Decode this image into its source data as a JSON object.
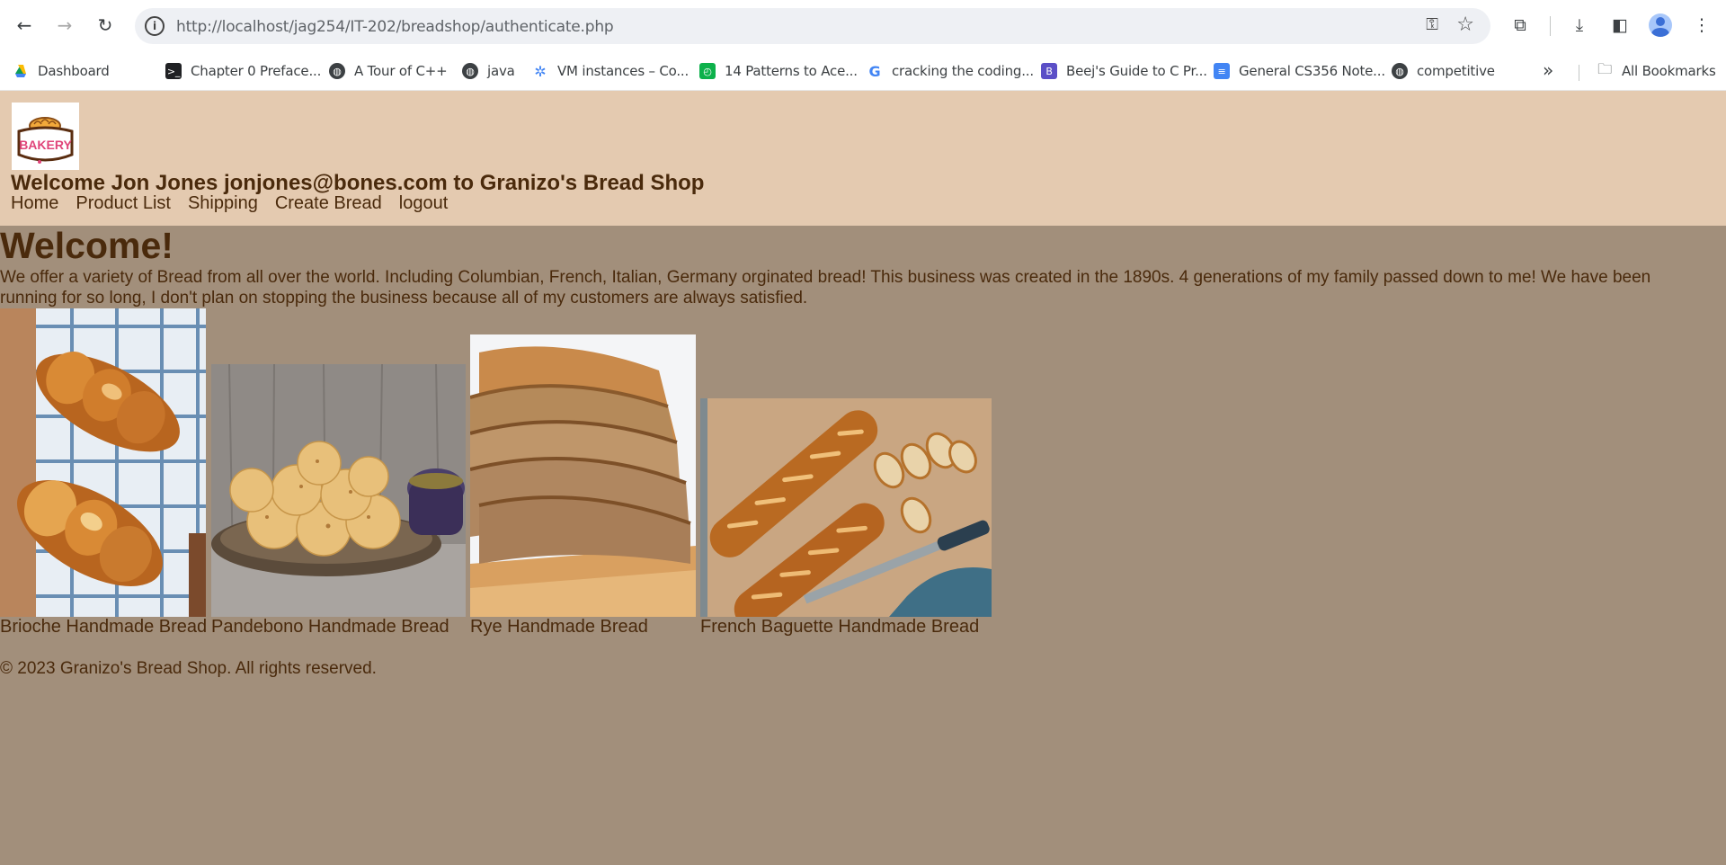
{
  "browser": {
    "url": "http://localhost/jag254/IT-202/breadshop/authenticate.php",
    "bookmarks": [
      {
        "label": "Dashboard",
        "icon": "google-drive-icon",
        "color": "#1a73e8"
      },
      {
        "label": "Chapter 0 Preface...",
        "icon": "terminal-icon",
        "color": "#202124"
      },
      {
        "label": "A Tour of C++",
        "icon": "globe-icon",
        "color": "#3c4043"
      },
      {
        "label": "java",
        "icon": "globe-icon",
        "color": "#3c4043"
      },
      {
        "label": "VM instances – Co...",
        "icon": "cloud-chip-icon",
        "color": "#4285f4"
      },
      {
        "label": "14 Patterns to Ace...",
        "icon": "clock-icon",
        "color": "#0db14b"
      },
      {
        "label": "cracking the coding...",
        "icon": "google-icon",
        "color": "#4285f4"
      },
      {
        "label": "Beej's Guide to C Pr...",
        "icon": "beej-icon",
        "color": "#5b4fc7"
      },
      {
        "label": "General CS356 Note...",
        "icon": "docs-icon",
        "color": "#4285f4"
      },
      {
        "label": "competitive",
        "icon": "globe-icon",
        "color": "#3c4043"
      }
    ],
    "all_bookmarks_label": "All Bookmarks"
  },
  "site": {
    "logo_text": "BAKERY",
    "welcome": "Welcome Jon Jones jonjones@bones.com to Granizo's Bread Shop",
    "nav": [
      "Home",
      "Product List",
      "Shipping",
      "Create Bread",
      "logout"
    ]
  },
  "main": {
    "title": "Welcome!",
    "intro": "We offer a variety of Bread from all over the world. Including Columbian, French, Italian, Germany orginated bread! This business was created in the 1890s. 4 generations of my family passed down to me! We have been running for so long, I don't plan on stopping the business because all of my customers are always satisfied.",
    "breads": [
      {
        "caption": "Brioche Handmade Bread"
      },
      {
        "caption": "Pandebono Handmade Bread"
      },
      {
        "caption": "Rye Handmade Bread"
      },
      {
        "caption": "French Baguette Handmade Bread"
      }
    ],
    "footer": "© 2023 Granizo's Bread Shop. All rights reserved."
  }
}
